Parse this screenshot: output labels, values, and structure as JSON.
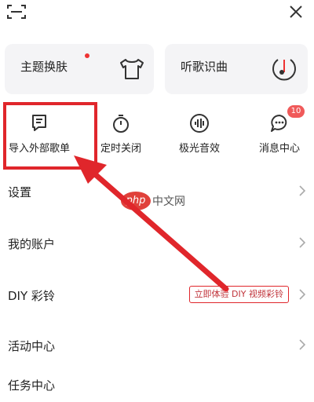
{
  "topbar": {
    "scan_icon": "scan-icon",
    "close_icon": "close-icon"
  },
  "cards": {
    "theme": {
      "label": "主题换肤",
      "icon": "tshirt-icon",
      "dot_color": "#e33333"
    },
    "recognize": {
      "label": "听歌识曲",
      "icon": "music-recognize-icon"
    }
  },
  "quick_actions": [
    {
      "label": "导入外部歌单",
      "icon": "import-playlist-icon"
    },
    {
      "label": "定时关闭",
      "icon": "timer-icon"
    },
    {
      "label": "极光音效",
      "icon": "sound-effect-icon"
    },
    {
      "label": "消息中心",
      "icon": "message-icon",
      "badge": "10"
    }
  ],
  "menu": {
    "settings": "设置",
    "account": "我的账户",
    "diy": "DIY 彩铃",
    "diy_button": "立即体验 DIY 视频彩铃",
    "activity": "活动中心",
    "task": "任务中心"
  },
  "watermark": {
    "logo": "php",
    "text": "中文网"
  },
  "colors": {
    "highlight": "#e0262b",
    "badge": "#f05a5a",
    "card_bg": "#f4f4f6"
  }
}
